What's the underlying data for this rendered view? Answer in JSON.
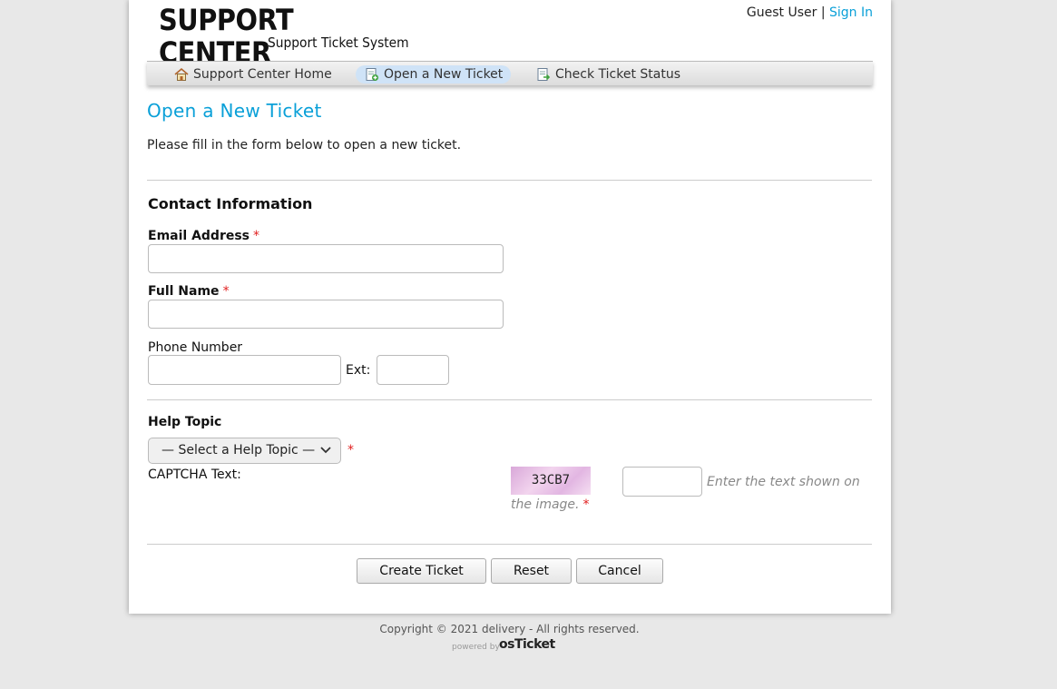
{
  "header": {
    "logo_title": "SUPPORT CENTER",
    "logo_subtitle": "Support Ticket System",
    "user_label": "Guest User",
    "separator": "|",
    "signin_label": "Sign In"
  },
  "nav": {
    "items": [
      {
        "label": "Support Center Home",
        "icon": "home-icon"
      },
      {
        "label": "Open a New Ticket",
        "icon": "new-ticket-icon",
        "active": true
      },
      {
        "label": "Check Ticket Status",
        "icon": "ticket-status-icon"
      }
    ]
  },
  "page": {
    "title": "Open a New Ticket",
    "intro": "Please fill in the form below to open a new ticket."
  },
  "contact": {
    "heading": "Contact Information",
    "email_label": "Email Address",
    "email_value": "",
    "name_label": "Full Name",
    "name_value": "",
    "phone_label": "Phone Number",
    "phone_value": "",
    "ext_label": "Ext:",
    "ext_value": "",
    "required_mark": "*"
  },
  "help_topic": {
    "heading": "Help Topic",
    "selected": "— Select a Help Topic —"
  },
  "captcha": {
    "label": "CAPTCHA Text:",
    "image_text": "33CB7",
    "hint_line1": "Enter the text shown on",
    "hint_line2": "the image.",
    "value": ""
  },
  "buttons": {
    "create": "Create Ticket",
    "reset": "Reset",
    "cancel": "Cancel"
  },
  "footer": {
    "copyright": "Copyright © 2021 delivery - All rights reserved.",
    "powered_by": "powered by",
    "brand": "osTicket"
  },
  "colors": {
    "accent": "#0aa0d8",
    "required": "#e12020",
    "background": "#e8e8e8"
  }
}
